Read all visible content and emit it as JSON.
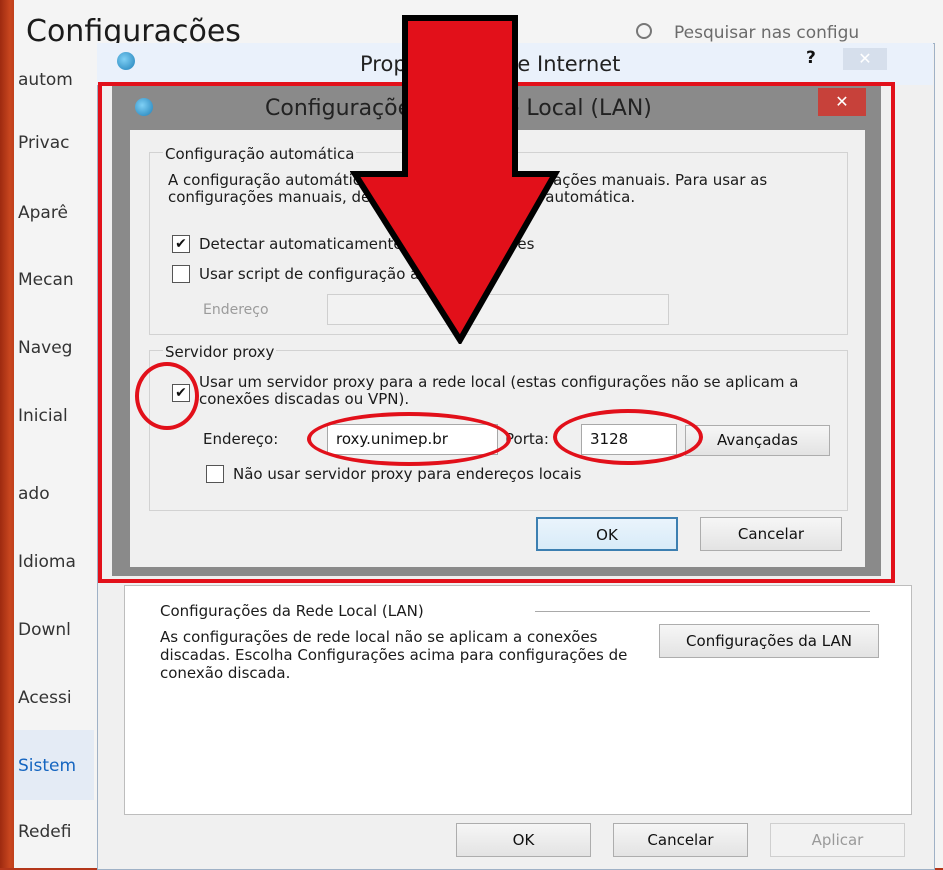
{
  "settings": {
    "title": "Configurações",
    "search_placeholder": "Pesquisar nas configu",
    "sidebar": [
      "autom",
      "Privac",
      "Aparê",
      "Mecan",
      "Naveg",
      "Inicial",
      "ado",
      "Idioma",
      "Downl",
      "Acessi",
      "Sistem",
      "Redefi"
    ],
    "active_item": "Sistem"
  },
  "internet_options": {
    "title": "Propriedades de Internet",
    "help_label": "?",
    "lan_group_label": "Configurações da Rede Local (LAN)",
    "lan_description": "As configurações de rede local não se aplicam a conexões discadas. Escolha Configurações acima para configurações de conexão discada.",
    "lan_button": "Configurações da LAN",
    "ok_button": "OK",
    "cancel_button": "Cancelar",
    "apply_button": "Aplicar"
  },
  "lan_dialog": {
    "title": "Configurações de Rede Local (LAN)",
    "auto_group": {
      "label": "Configuração automática",
      "description": "A configuração automática pode anular as configurações manuais. Para usar as configurações manuais, desabilite a configuração automática.",
      "detect_label": "Detectar automaticamente as configurações",
      "detect_checked": true,
      "script_label": "Usar script de configuração automática",
      "script_checked": false,
      "address_label": "Endereço",
      "address_value": ""
    },
    "proxy_group": {
      "label": "Servidor proxy",
      "use_proxy_label": "Usar um servidor proxy para a rede local (estas configurações não se aplicam a conexões discadas ou VPN).",
      "use_proxy_checked": true,
      "address_label": "Endereço:",
      "address_value": "roxy.unimep.br",
      "port_label": "Porta:",
      "port_value": "3128",
      "advanced_button": "Avançadas",
      "bypass_label": "Não usar servidor proxy para endereços locais",
      "bypass_checked": false
    },
    "ok_button": "OK",
    "cancel_button": "Cancelar"
  },
  "colors": {
    "annotation_red": "#e2101a",
    "background_orange": "#c5451e",
    "close_red": "#c7413a"
  },
  "icons": {
    "check": "✔",
    "close": "✕"
  }
}
